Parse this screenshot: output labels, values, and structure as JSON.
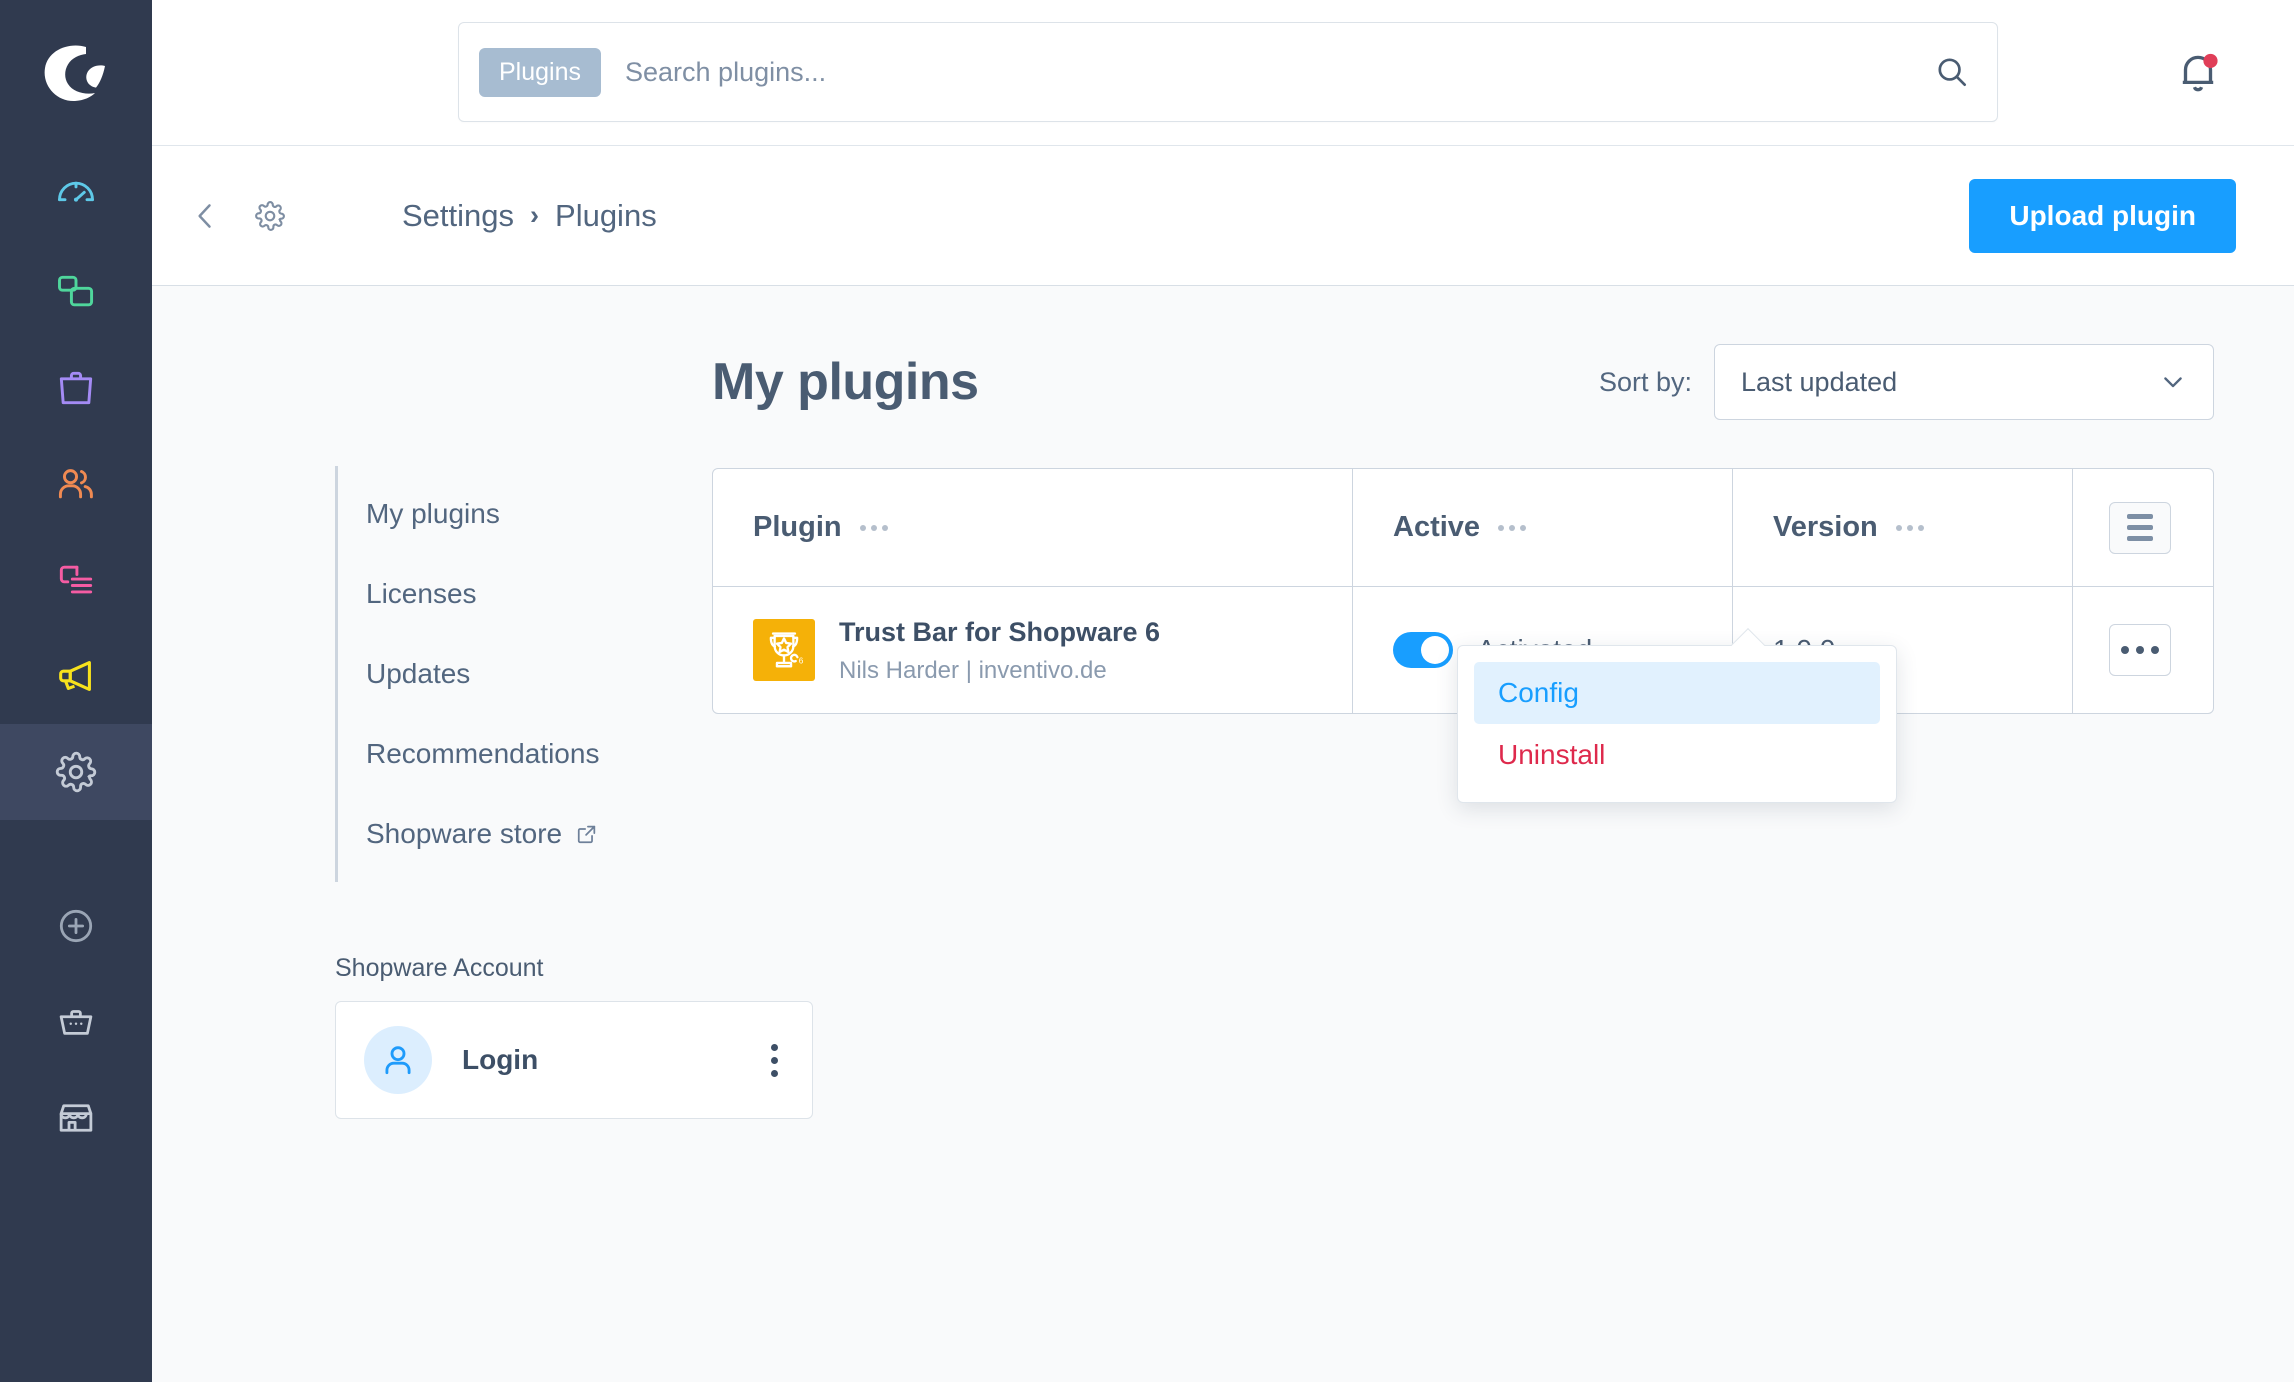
{
  "app": {
    "logo_icon": "shopware-logo",
    "accent_blue": "#189EFF",
    "sidebar_bg": "#303A4F",
    "page_bg": "#F9FAFB",
    "danger_red": "#DE294C",
    "plugin_icon_bg": "#F5B108"
  },
  "sidebar": {
    "items": [
      {
        "icon": "dashboard-gauge-icon",
        "color": "#5EC9E8",
        "active": false
      },
      {
        "icon": "catalogues-squares-icon",
        "color": "#4FD69C",
        "active": false
      },
      {
        "icon": "orders-bag-icon",
        "color": "#A48BF5",
        "active": false
      },
      {
        "icon": "customers-people-icon",
        "color": "#F08A52",
        "active": false
      },
      {
        "icon": "content-document-icon",
        "color": "#F55CA3",
        "active": false
      },
      {
        "icon": "marketing-megaphone-icon",
        "color": "#F7E11C",
        "active": false
      },
      {
        "icon": "settings-gear-icon",
        "color": "#C4CBD6",
        "active": true
      }
    ],
    "footer_items": [
      {
        "icon": "plus-circle-icon",
        "color": "#9AA5B5"
      },
      {
        "icon": "shopping-basket-icon",
        "color": "#C4CBD6"
      },
      {
        "icon": "storefront-icon",
        "color": "#C4CBD6"
      }
    ]
  },
  "search": {
    "scope_badge": "Plugins",
    "placeholder": "Search plugins...",
    "value": "",
    "icon": "search-icon"
  },
  "notifications": {
    "icon": "bell-icon",
    "has_unread": true,
    "dot_color": "#E03E58"
  },
  "toolbar": {
    "back_icon": "chevron-left-icon",
    "gear_icon": "gear-icon",
    "breadcrumb": {
      "parent": "Settings",
      "separator": "›",
      "current": "Plugins"
    },
    "upload_label": "Upload plugin"
  },
  "side_nav": {
    "items": [
      {
        "label": "My plugins",
        "external": false,
        "active": true
      },
      {
        "label": "Licenses",
        "external": false,
        "active": false
      },
      {
        "label": "Updates",
        "external": false,
        "active": false
      },
      {
        "label": "Recommendations",
        "external": false,
        "active": false
      },
      {
        "label": "Shopware store",
        "external": true,
        "active": false
      }
    ],
    "external_icon": "external-link-icon"
  },
  "account": {
    "section_title": "Shopware Account",
    "avatar_icon": "user-avatar-icon",
    "name": "Login",
    "menu_icon": "kebab-menu-icon"
  },
  "main": {
    "title": "My plugins",
    "sort": {
      "label": "Sort by:",
      "value": "Last updated",
      "chevron_icon": "chevron-down-icon"
    },
    "table": {
      "columns": [
        {
          "label": "Plugin",
          "menu_icon": "column-options-icon"
        },
        {
          "label": "Active",
          "menu_icon": "column-options-icon"
        },
        {
          "label": "Version",
          "menu_icon": "column-options-icon"
        }
      ],
      "settings_icon": "list-settings-icon",
      "rows": [
        {
          "icon": "trophy-star-icon",
          "name": "Trust Bar for Shopware 6",
          "author": "Nils Harder | inventivo.de",
          "active_state": true,
          "active_label": "Activated",
          "version": "1.0.0",
          "row_menu_icon": "context-menu-dots-icon"
        }
      ]
    },
    "context_menu": {
      "open": true,
      "items": [
        {
          "label": "Config",
          "kind": "highlighted"
        },
        {
          "label": "Uninstall",
          "kind": "danger"
        }
      ]
    }
  }
}
